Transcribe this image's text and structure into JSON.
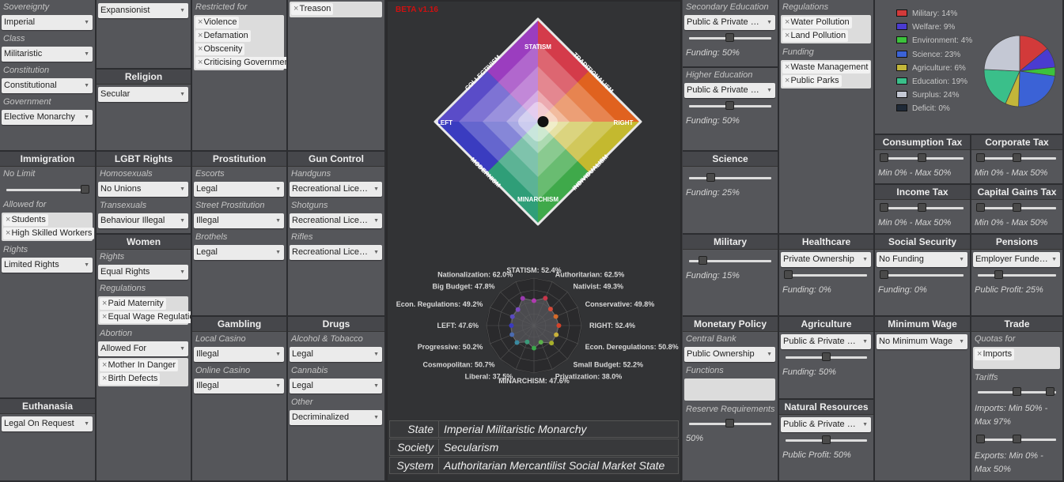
{
  "beta": "BETA v1.16",
  "col1": {
    "sovereignty": {
      "label": "Sovereignty",
      "value": "Imperial"
    },
    "class": {
      "label": "Class",
      "value": "Militaristic"
    },
    "constitution": {
      "label": "Constitution",
      "value": "Constitutional"
    },
    "government": {
      "label": "Government",
      "value": "Elective Monarchy"
    },
    "immigration": {
      "title": "Immigration",
      "level_label": "No Limit",
      "level": 1.0,
      "allowed_label": "Allowed for",
      "allowed": [
        "Students",
        "High Skilled Workers"
      ],
      "rights_label": "Rights",
      "rights": "Limited Rights"
    },
    "euthanasia": {
      "title": "Euthanasia",
      "value": "Legal On Request"
    }
  },
  "col2": {
    "economy_top": "Expansionist",
    "religion": {
      "title": "Religion",
      "value": "Secular"
    },
    "lgbt": {
      "title": "LGBT Rights",
      "homo_label": "Homosexuals",
      "homo": "No Unions",
      "trans_label": "Transexuals",
      "trans": "Behaviour Illegal"
    },
    "women": {
      "title": "Women",
      "rights_label": "Rights",
      "rights": "Equal Rights",
      "reg_label": "Regulations",
      "regs": [
        "Paid Maternity",
        "Equal Wage Regulations"
      ],
      "abortion_label": "Abortion",
      "abortion": "Allowed For",
      "abortion_tags": [
        "Mother In Danger",
        "Birth Defects"
      ]
    }
  },
  "col3": {
    "restricted_label": "Restricted for",
    "restricted": [
      "Violence",
      "Defamation",
      "Obscenity",
      "Criticising Government"
    ],
    "prostitution": {
      "title": "Prostitution",
      "escorts_label": "Escorts",
      "escorts": "Legal",
      "street_label": "Street Prostitution",
      "street": "Illegal",
      "brothels_label": "Brothels",
      "brothels": "Legal"
    },
    "gambling": {
      "title": "Gambling",
      "local_label": "Local Casino",
      "local": "Illegal",
      "online_label": "Online Casino",
      "online": "Illegal"
    }
  },
  "col4": {
    "treason": "Treason",
    "gun": {
      "title": "Gun Control",
      "handguns_label": "Handguns",
      "handguns": "Recreational Licence",
      "shotguns_label": "Shotguns",
      "shotguns": "Recreational Licence",
      "rifles_label": "Rifles",
      "rifles": "Recreational Licence"
    },
    "drugs": {
      "title": "Drugs",
      "alcohol_label": "Alcohol & Tobacco",
      "alcohol": "Legal",
      "cannabis_label": "Cannabis",
      "cannabis": "Legal",
      "other_label": "Other",
      "other": "Decriminalized"
    }
  },
  "compass": {
    "labels": {
      "top": "STATISM",
      "bottom": "MINARCHISM",
      "left": "LEFT",
      "right": "RIGHT",
      "tl": "COLLECTIVISM",
      "tr": "TRADITIONALISM",
      "bl": "MODERNISM",
      "br": "INDIVIDUALISM"
    },
    "dot": {
      "x": 0.05,
      "y": 0.0
    }
  },
  "radar": {
    "axes": [
      {
        "label": "STATISM: 52.4%",
        "value": 52.4
      },
      {
        "label": "Authoritarian: 62.5%",
        "value": 62.5
      },
      {
        "label": "Nativist: 49.3%",
        "value": 49.3
      },
      {
        "label": "Conservative: 49.8%",
        "value": 49.8
      },
      {
        "label": "RIGHT: 52.4%",
        "value": 52.4
      },
      {
        "label": "Econ. Deregulations: 50.8%",
        "value": 50.8
      },
      {
        "label": "Small Budget: 52.2%",
        "value": 52.2
      },
      {
        "label": "Privatization: 38.0%",
        "value": 38.0
      },
      {
        "label": "MINARCHISM: 47.6%",
        "value": 47.6
      },
      {
        "label": "Liberal: 37.5%",
        "value": 37.5
      },
      {
        "label": "Cosmopolitan: 50.7%",
        "value": 50.7
      },
      {
        "label": "Progressive: 50.2%",
        "value": 50.2
      },
      {
        "label": "LEFT: 47.6%",
        "value": 47.6
      },
      {
        "label": "Econ. Regulations: 49.2%",
        "value": 49.2
      },
      {
        "label": "Big Budget: 47.8%",
        "value": 47.8
      },
      {
        "label": "Nationalization: 62.0%",
        "value": 62.0
      }
    ]
  },
  "identity": [
    {
      "key": "State",
      "value": "Imperial Militaristic Monarchy"
    },
    {
      "key": "Society",
      "value": "Secularism"
    },
    {
      "key": "System",
      "value": "Authoritarian Mercantilist Social Market State"
    }
  ],
  "col5": {
    "secondary": {
      "title": "Secondary Education",
      "value": "Public & Private Ownership",
      "funding_label": "Funding: 50%",
      "funding": 0.5
    },
    "higher": {
      "title": "Higher Education",
      "value": "Public & Private Ownership",
      "funding_label": "Funding: 50%",
      "funding": 0.5
    },
    "science": {
      "title": "Science",
      "funding_label": "Funding: 25%",
      "funding": 0.25
    },
    "military": {
      "title": "Military",
      "funding_label": "Funding: 15%",
      "funding": 0.15
    },
    "monetary": {
      "title": "Monetary Policy",
      "bank_label": "Central Bank",
      "bank": "Public Ownership",
      "functions_label": "Functions",
      "reserve_label": "Reserve Requirements",
      "reserve": 0.5,
      "reserve_value": "50%"
    }
  },
  "col6": {
    "regs_label": "Regulations",
    "regs": [
      "Water Pollution",
      "Land Pollution"
    ],
    "funding_label": "Funding",
    "funding": [
      "Waste Management",
      "Public Parks"
    ],
    "healthcare": {
      "title": "Healthcare",
      "value": "Private Ownership",
      "funding_label": "Funding: 0%",
      "funding": 0.0
    },
    "agriculture": {
      "title": "Agriculture",
      "value": "Public & Private Ownership",
      "funding_label": "Funding: 50%",
      "funding": 0.5
    },
    "natural": {
      "title": "Natural Resources",
      "value": "Public & Private Ownership",
      "profit_label": "Public Profit: 50%",
      "profit": 0.5
    }
  },
  "budget": {
    "legend": [
      {
        "label": "Military: 14%",
        "color": "#d23a3a"
      },
      {
        "label": "Welfare: 9%",
        "color": "#4a3bd0"
      },
      {
        "label": "Environment: 4%",
        "color": "#3cc23c"
      },
      {
        "label": "Science: 23%",
        "color": "#3b62d6"
      },
      {
        "label": "Agriculture: 6%",
        "color": "#c2b63a"
      },
      {
        "label": "Education: 19%",
        "color": "#3abf8a"
      },
      {
        "label": "Surplus: 24%",
        "color": "#c4c8d4"
      },
      {
        "label": "Deficit: 0%",
        "color": "#1f2a38"
      }
    ],
    "chart_data": {
      "type": "pie",
      "categories": [
        "Military",
        "Welfare",
        "Environment",
        "Science",
        "Agriculture",
        "Education",
        "Surplus",
        "Deficit"
      ],
      "values": [
        14,
        9,
        4,
        23,
        6,
        19,
        24,
        0
      ]
    }
  },
  "col7": {
    "consumption": {
      "title": "Consumption Tax",
      "range": "Min 0% - Max 50%",
      "min": 0.0,
      "max": 0.5
    },
    "income": {
      "title": "Income Tax",
      "range": "Min 0% - Max 50%",
      "min": 0.0,
      "max": 0.5
    },
    "social": {
      "title": "Social Security",
      "value": "No Funding",
      "funding_label": "Funding: 0%",
      "funding": 0.0
    },
    "minwage": {
      "title": "Minimum Wage",
      "value": "No Minimum Wage"
    }
  },
  "col8": {
    "corporate": {
      "title": "Corporate Tax",
      "range": "Min 0% - Max 50%",
      "min": 0.0,
      "max": 0.5
    },
    "capital": {
      "title": "Capital Gains Tax",
      "range": "Min 0% - Max 50%",
      "min": 0.0,
      "max": 0.5
    },
    "pensions": {
      "title": "Pensions",
      "value": "Employer Funded Pensions",
      "profit_label": "Public Profit: 25%",
      "profit": 0.25
    },
    "trade": {
      "title": "Trade",
      "quotas_label": "Quotas for",
      "quotas": [
        "Imports"
      ],
      "tariffs_label": "Tariffs",
      "imports_range": "Imports: Min 50% - Max 97%",
      "imports_min": 0.5,
      "imports_max": 0.97,
      "exports_range": "Exports: Min 0% - Max 50%",
      "exports_min": 0.0,
      "exports_max": 0.5
    }
  }
}
